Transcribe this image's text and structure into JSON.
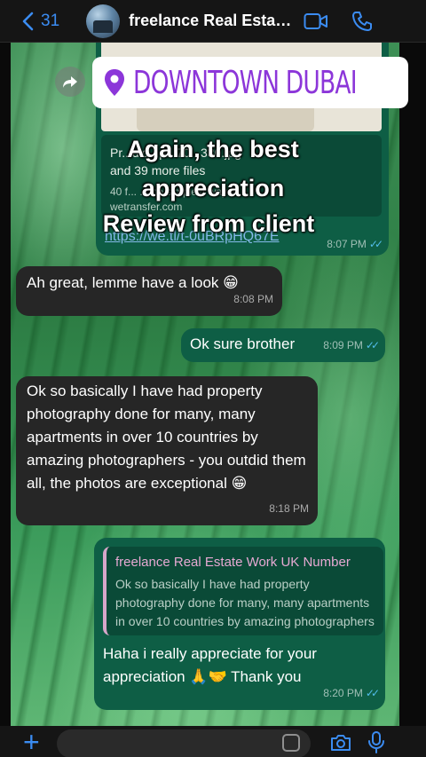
{
  "header": {
    "back_count": "31",
    "contact_name": "freelance Real Estate...",
    "accent_color": "#3b8cf2"
  },
  "link_message": {
    "file_line": "Pr...did...p...70...330.jpg",
    "more_files": "and 39 more files",
    "description": "40 f... ...the simplest way to...",
    "site": "wetransfer.com",
    "url": "https://we.tl/t-0uBRpHQ67E",
    "time": "8:07 PM"
  },
  "location_sticker": {
    "text": "DOWNTOWN DUBAI",
    "icon": "map-pin-icon",
    "color": "#8c36d9"
  },
  "overlay": {
    "line1": "Again, the best",
    "line2": "appreciation",
    "line3": "Review from client"
  },
  "messages": {
    "m1": {
      "text": "Ah great, lemme have a look 😁",
      "time": "8:08 PM"
    },
    "m2": {
      "text": "Ok sure brother",
      "time": "8:09 PM"
    },
    "m3": {
      "text": "Ok so basically I have had property photography done for many, many apartments in over 10 countries by amazing photographers - you outdid them all, the photos are exceptional 😁",
      "time": "8:18 PM"
    },
    "m4": {
      "quote_name": "freelance Real Estate Work UK Number",
      "quote_text": "Ok so basically I have had property photography done for many, many apartments in over 10 countries by amazing photographers",
      "text": "Haha i really appreciate for your appreciation 🙏🤝 Thank you",
      "time": "8:20 PM"
    }
  },
  "composer": {
    "plus_label": "+",
    "icons": [
      "plus-icon",
      "sticker-icon",
      "camera-icon",
      "microphone-icon"
    ]
  }
}
